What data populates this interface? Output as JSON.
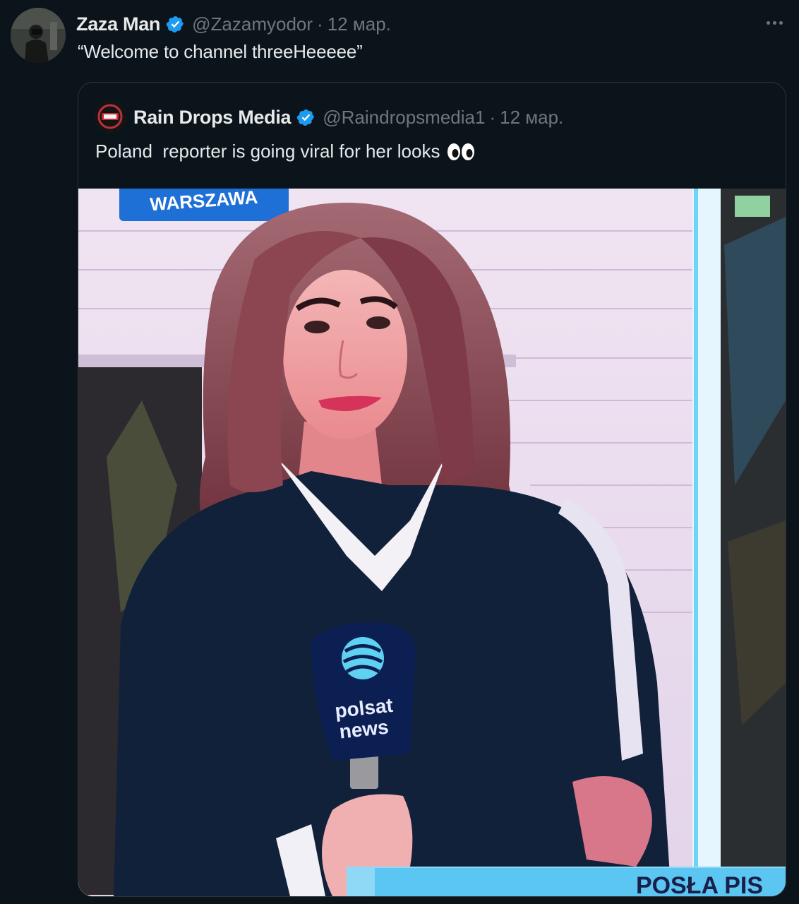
{
  "tweet": {
    "author_name": "Zaza Man",
    "author_handle": "@Zazamyodor",
    "separator": "·",
    "date": "12 мар.",
    "text": "“Welcome to channel threeHeeeee”",
    "more_icon": "more-horizontal-icon",
    "verified_icon": "verified-badge-icon",
    "accent_color": "#1d9bf0"
  },
  "quoted_tweet": {
    "author_name": "Rain Drops Media",
    "author_handle": "@Raindropsmedia1",
    "separator": "·",
    "date": "12 мар.",
    "text": "Poland  reporter is going viral for her looks",
    "emoji_icon": "eyes-icon",
    "media": {
      "location_tag": "WARSZAWA",
      "mic_brand_line1": "polsat",
      "mic_brand_line2": "news",
      "ticker_text": "POSŁA PIS"
    }
  }
}
